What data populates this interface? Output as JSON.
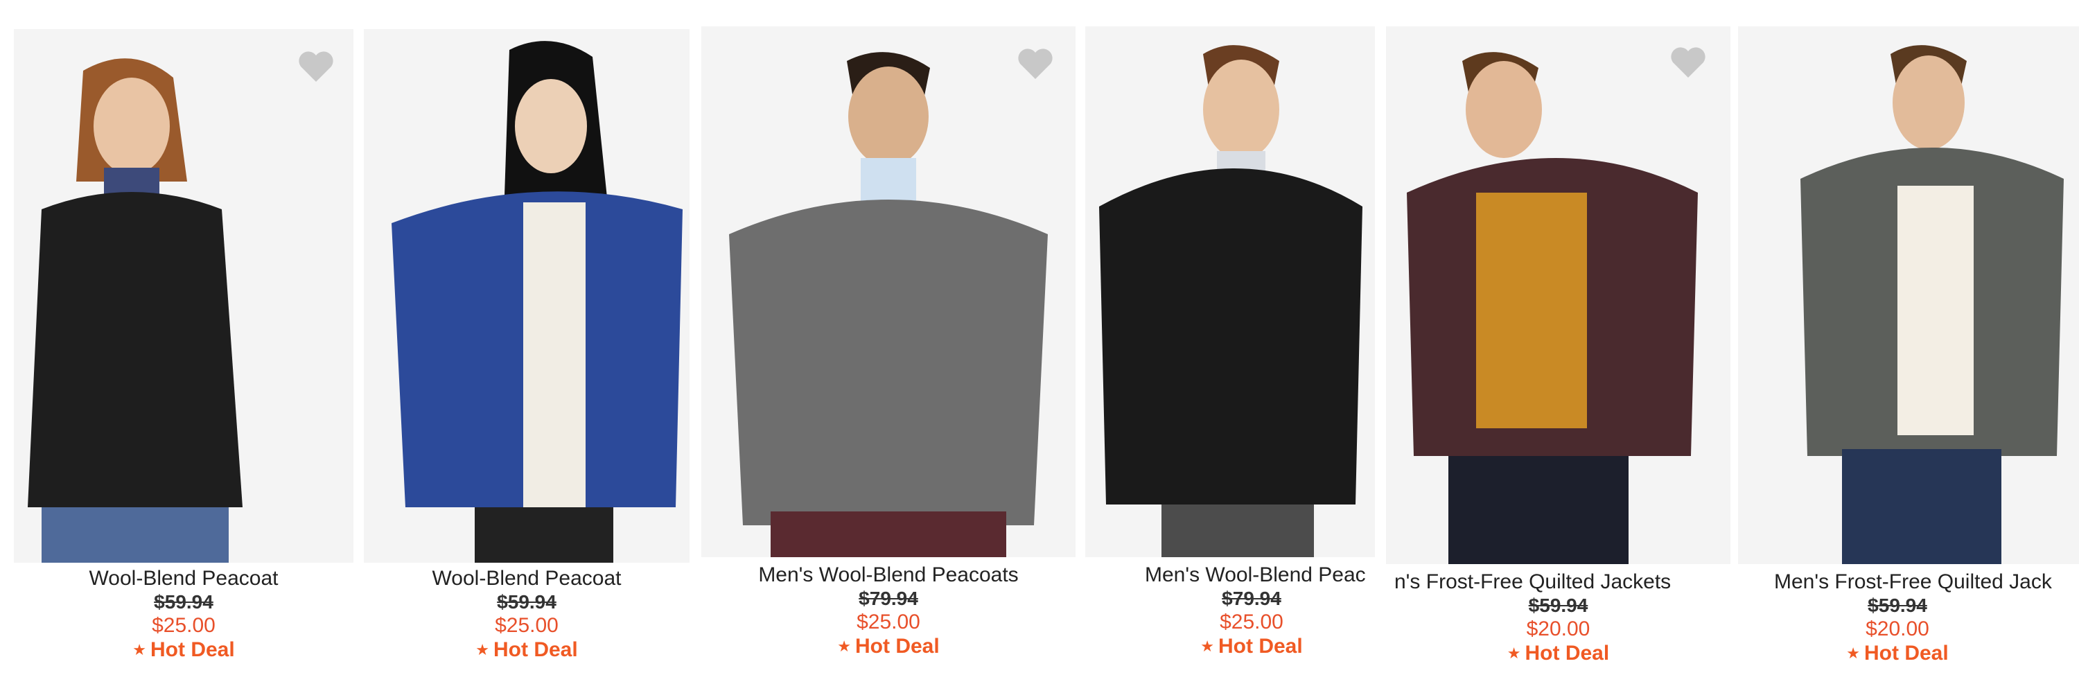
{
  "colors": {
    "sale": "#e8502b",
    "hot_deal": "#f05a23",
    "heart": "#c8c8c8",
    "photo_bg": "#f4f4f4"
  },
  "products": [
    {
      "name": "Wool-Blend Peacoat",
      "was": "$59.94",
      "now": "$25.00",
      "deal": "Hot Deal",
      "deal_icon": "star-icon",
      "favorite_icon": "heart-icon",
      "coat_color": "#1e1e1e",
      "inner_color": "#3d4a7a"
    },
    {
      "name": "Wool-Blend Peacoat",
      "was": "$59.94",
      "now": "$25.00",
      "deal": "Hot Deal",
      "deal_icon": "star-icon",
      "coat_color": "#2c4a9a",
      "inner_color": "#f1ede4"
    },
    {
      "name": "Men's Wool-Blend Peacoats",
      "was": "$79.94",
      "now": "$25.00",
      "deal": "Hot Deal",
      "deal_icon": "star-icon",
      "favorite_icon": "heart-icon",
      "coat_color": "#6e6e6e",
      "inner_color": "#cfe0f0"
    },
    {
      "name": "Men's Wool-Blend Peac",
      "was": "$79.94",
      "now": "$25.00",
      "deal": "Hot Deal",
      "deal_icon": "star-icon",
      "coat_color": "#1a1a1a",
      "inner_color": "#d9dde3"
    },
    {
      "name": "n's Frost-Free Quilted Jackets",
      "was": "$59.94",
      "now": "$20.00",
      "deal": "Hot Deal",
      "deal_icon": "star-icon",
      "favorite_icon": "heart-icon",
      "coat_color": "#4a2a2e",
      "inner_color": "#c98a25"
    },
    {
      "name": "Men's Frost-Free Quilted Jack",
      "was": "$59.94",
      "now": "$20.00",
      "deal": "Hot Deal",
      "deal_icon": "star-icon",
      "coat_color": "#5c5f5b",
      "inner_color": "#f3eee4"
    }
  ]
}
